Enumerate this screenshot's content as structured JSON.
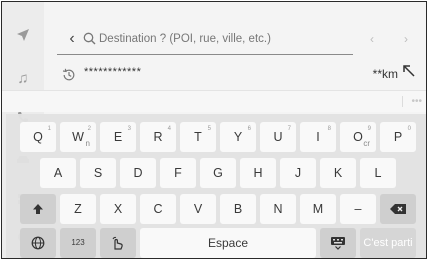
{
  "search": {
    "placeholder": "Destination ? (POI, rue, ville, etc.)"
  },
  "result": {
    "name": "************",
    "distance": "**km"
  },
  "keyboard": {
    "row1": [
      {
        "label": "Q",
        "num": "1"
      },
      {
        "label": "W",
        "num": "2",
        "accent": "n"
      },
      {
        "label": "E",
        "num": "3"
      },
      {
        "label": "R",
        "num": "4"
      },
      {
        "label": "T",
        "num": "5"
      },
      {
        "label": "Y",
        "num": "6"
      },
      {
        "label": "U",
        "num": "7"
      },
      {
        "label": "I",
        "num": "8"
      },
      {
        "label": "O",
        "num": "9",
        "accent": "cr"
      },
      {
        "label": "P",
        "num": "0"
      }
    ],
    "row2": [
      "A",
      "S",
      "D",
      "F",
      "G",
      "H",
      "J",
      "K",
      "L"
    ],
    "row3": [
      "Z",
      "X",
      "C",
      "V",
      "B",
      "N",
      "M",
      "–"
    ],
    "numbers_label": "123",
    "space_label": "Espace",
    "ok_label": "C'est parti"
  },
  "suggest": {
    "more_label": "•••"
  },
  "icons": {
    "rail": [
      "navigation-arrow-icon",
      "music-note-icon",
      "phone-icon",
      "car-icon",
      "apps-icon",
      "settings-icon"
    ],
    "search": "search-icon",
    "history": "history-icon",
    "direction": "direction-arrow-icon"
  }
}
